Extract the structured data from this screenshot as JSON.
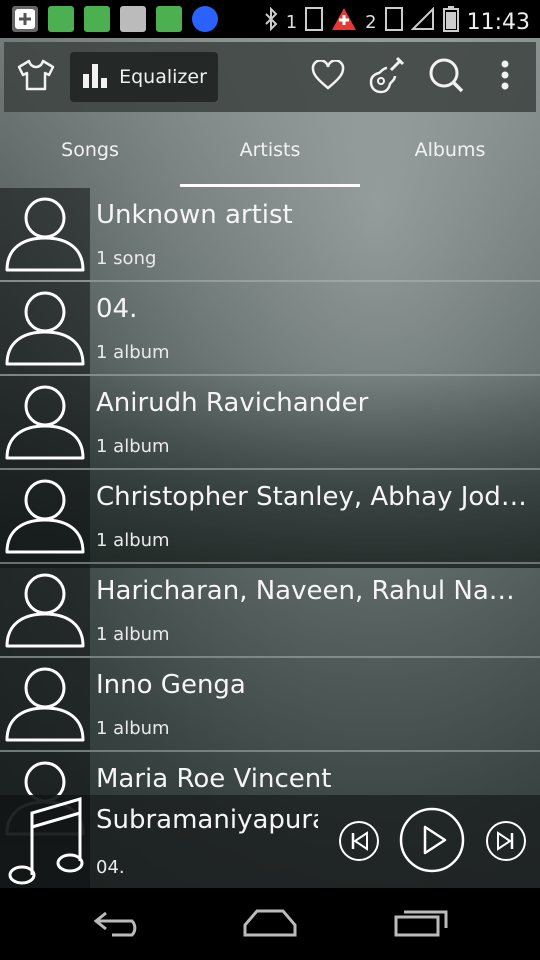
{
  "statusbar": {
    "time": "11:43",
    "notif1_count": "1",
    "notif2_count": "2",
    "colors": {
      "green": "#4caf50",
      "blue": "#2962ff",
      "red": "#e53935"
    }
  },
  "toolbar": {
    "equalizer_label": "Equalizer",
    "icons": [
      "shirt-icon",
      "equalizer-icon",
      "heart-icon",
      "guitar-icon",
      "search-icon",
      "more-vert-icon"
    ]
  },
  "tabs": [
    {
      "label": "Songs",
      "active": false
    },
    {
      "label": "Artists",
      "active": true
    },
    {
      "label": "Albums",
      "active": false
    }
  ],
  "artists": [
    {
      "name": "Unknown artist",
      "meta": "1 song"
    },
    {
      "name": "04.",
      "meta": "1 album"
    },
    {
      "name": "Anirudh Ravichander",
      "meta": "1 album"
    },
    {
      "name": "Christopher Stanley, Abhay Jodhpurkar",
      "meta": "1 album"
    },
    {
      "name": "Haricharan, Naveen, Rahul Nambiar",
      "meta": "1 album"
    },
    {
      "name": "Inno Genga",
      "meta": "1 album"
    },
    {
      "name": "Maria Roe Vincent",
      "meta": ""
    }
  ],
  "now_playing": {
    "title": "Subramaniyapuram",
    "subtitle": "04."
  },
  "navbar": {
    "icons": [
      "back-icon",
      "home-icon",
      "recents-icon"
    ]
  }
}
